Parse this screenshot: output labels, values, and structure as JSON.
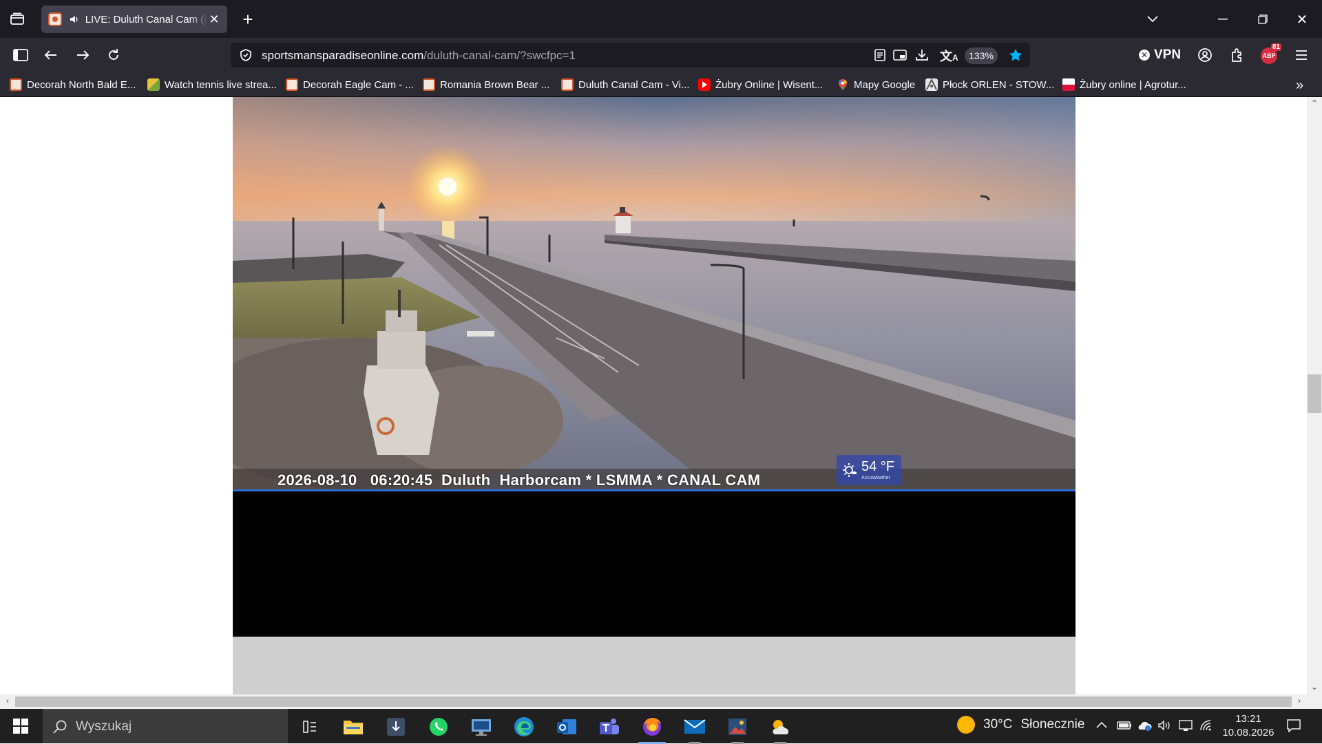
{
  "tabs": [
    {
      "title": "LIVE: Duluth Canal Cam (Live)",
      "audio": "speaker-icon",
      "active": true
    }
  ],
  "window_controls": {
    "minimize": "minimize-icon",
    "restore": "restore-icon",
    "close": "close-icon"
  },
  "urlbar": {
    "domain": "sportsmansparadiseonline.com",
    "path": "/duluth-canal-cam/?swcfpc=1",
    "zoom": "133%"
  },
  "toolbar": {
    "vpn_label": "VPN",
    "vpn_status_symbol": "✕",
    "extension_badge_count": "81",
    "extension_badge_text": "ABP"
  },
  "bookmarks": [
    {
      "label": "Decorah North Bald E...",
      "icon": "cam-favicon"
    },
    {
      "label": "Watch tennis live strea...",
      "icon": "tennis-favicon"
    },
    {
      "label": "Decorah Eagle Cam - ...",
      "icon": "cam-favicon"
    },
    {
      "label": "Romania Brown Bear ...",
      "icon": "cam-favicon"
    },
    {
      "label": "Duluth Canal Cam - Vi...",
      "icon": "cam-favicon"
    },
    {
      "label": "Żubry Online | Wisent...",
      "icon": "youtube-favicon"
    },
    {
      "label": "Mapy Google",
      "icon": "maps-pin-favicon"
    },
    {
      "label": "Płock ORLEN - STOW...",
      "icon": "orlen-favicon"
    },
    {
      "label": "Żubry online | Agrotur...",
      "icon": "poland-flag-favicon"
    }
  ],
  "video": {
    "caption": "2026-08-10   06:20:45  Duluth  Harborcam * LSMMA * CANAL CAM",
    "weather_temp": "54 °F",
    "weather_brand": "AccuWeather",
    "weather_icon": "partly-sunny-icon"
  },
  "taskbar": {
    "search_placeholder": "Wyszukaj",
    "apps": [
      "task-view-icon",
      "file-explorer-icon",
      "app-icon",
      "whatsapp-icon",
      "remote-desktop-icon",
      "edge-icon",
      "outlook-icon",
      "teams-icon",
      "firefox-icon",
      "mail-icon",
      "media-app-icon",
      "weather-app-icon"
    ],
    "weather_temp": "30°C",
    "weather_desc": "Słonecznie",
    "time": "13:21",
    "date": "10.08.2026"
  },
  "colors": {
    "tab_bar": "#1c1b22",
    "toolbar": "#2b2a33",
    "accent_star": "#00b3f4",
    "taskbar": "#202020",
    "video_line": "#2f6bd6"
  }
}
